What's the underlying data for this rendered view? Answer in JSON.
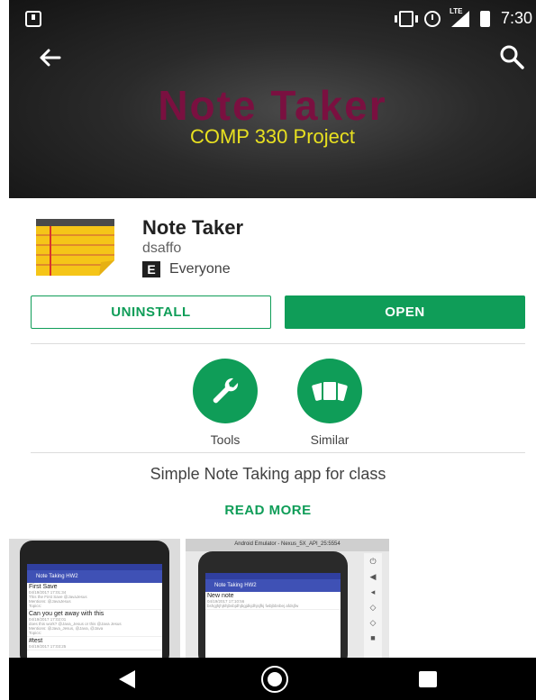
{
  "status_bar": {
    "lte": "LTE",
    "time": "7:30"
  },
  "header": {
    "banner_title": "Note Taker",
    "banner_subtitle": "COMP 330 Project"
  },
  "app": {
    "name": "Note Taker",
    "developer": "dsaffo",
    "rating_icon": "E",
    "rating_label": "Everyone"
  },
  "actions": {
    "uninstall": "UNINSTALL",
    "open": "OPEN"
  },
  "categories": [
    {
      "label": "Tools",
      "icon": "wrench-icon"
    },
    {
      "label": "Similar",
      "icon": "cards-icon"
    }
  ],
  "description": "Simple Note Taking app for class",
  "read_more": "READ MORE",
  "screenshots": {
    "shot1": {
      "app_bar": "Note Taking HW2",
      "notes": [
        {
          "title": "First Save",
          "date": "04/19/2017 17:01:34",
          "body": "This the First Save @JavaJesus",
          "mentions": "Mentions: @JavaJesus",
          "topics": "Topics:"
        },
        {
          "title": "Can you get away with this",
          "date": "04/19/2017 17:02:01",
          "body": "does this work? @Java_Jesus or this @Java Jesus",
          "mentions": "Mentions: @Java_Jesus, @Java, @Java",
          "topics": "Topics:"
        },
        {
          "title": "#test",
          "date": "04/19/2017 17:03:25",
          "body": "",
          "mentions": "",
          "topics": ""
        }
      ]
    },
    "shot2": {
      "window_title": "Android Emulator - Nexus_5X_API_25:5554",
      "app_bar": "Note Taking HW2",
      "note_title": "New note",
      "note_date": "04/19/2017 17:10:56",
      "note_body": "bshgjhjhjkhjbsbjdhjbgjdkjdhjsjfkj fwbjbbnbej afdsjfw"
    }
  },
  "colors": {
    "accent": "#0f9d58",
    "banner_title": "#7a1040",
    "banner_subtitle": "#e8e020"
  }
}
